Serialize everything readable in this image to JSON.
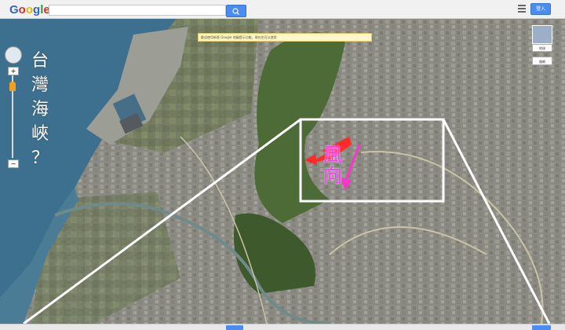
{
  "header": {
    "logo": [
      "G",
      "o",
      "o",
      "g",
      "l",
      "e"
    ],
    "logo_colors": [
      "#3366cc",
      "#cc3333",
      "#ffcc00",
      "#3366cc",
      "#339933",
      "#cc3333"
    ],
    "search_value": "",
    "signin_label": "登入"
  },
  "notice": {
    "text": "歡迎使用新版 Google 地圖提示功能，現在也可以使用"
  },
  "overlay": {
    "vertical_chars": [
      "台",
      "灣",
      "海",
      "峽",
      "？"
    ],
    "direction_label": [
      "風",
      "向"
    ]
  },
  "layers": {
    "thumb_label": "地球",
    "button_label": "路網"
  },
  "colors": {
    "sea": "#3f6f8c",
    "urban": "#8a8a82",
    "hills": "#4a6a35",
    "highlight_box": "#ffffff",
    "red_arrow": "#ff2a2a",
    "pink_arrow": "#ff33cc",
    "pink_text": "#ff33ff",
    "accent": "#4a8cf0"
  },
  "icons": {
    "menu": "menu-icon",
    "pan": "pan-control-icon",
    "pegman": "pegman-icon",
    "zoom_in": "plus-icon",
    "zoom_out": "minus-icon"
  }
}
